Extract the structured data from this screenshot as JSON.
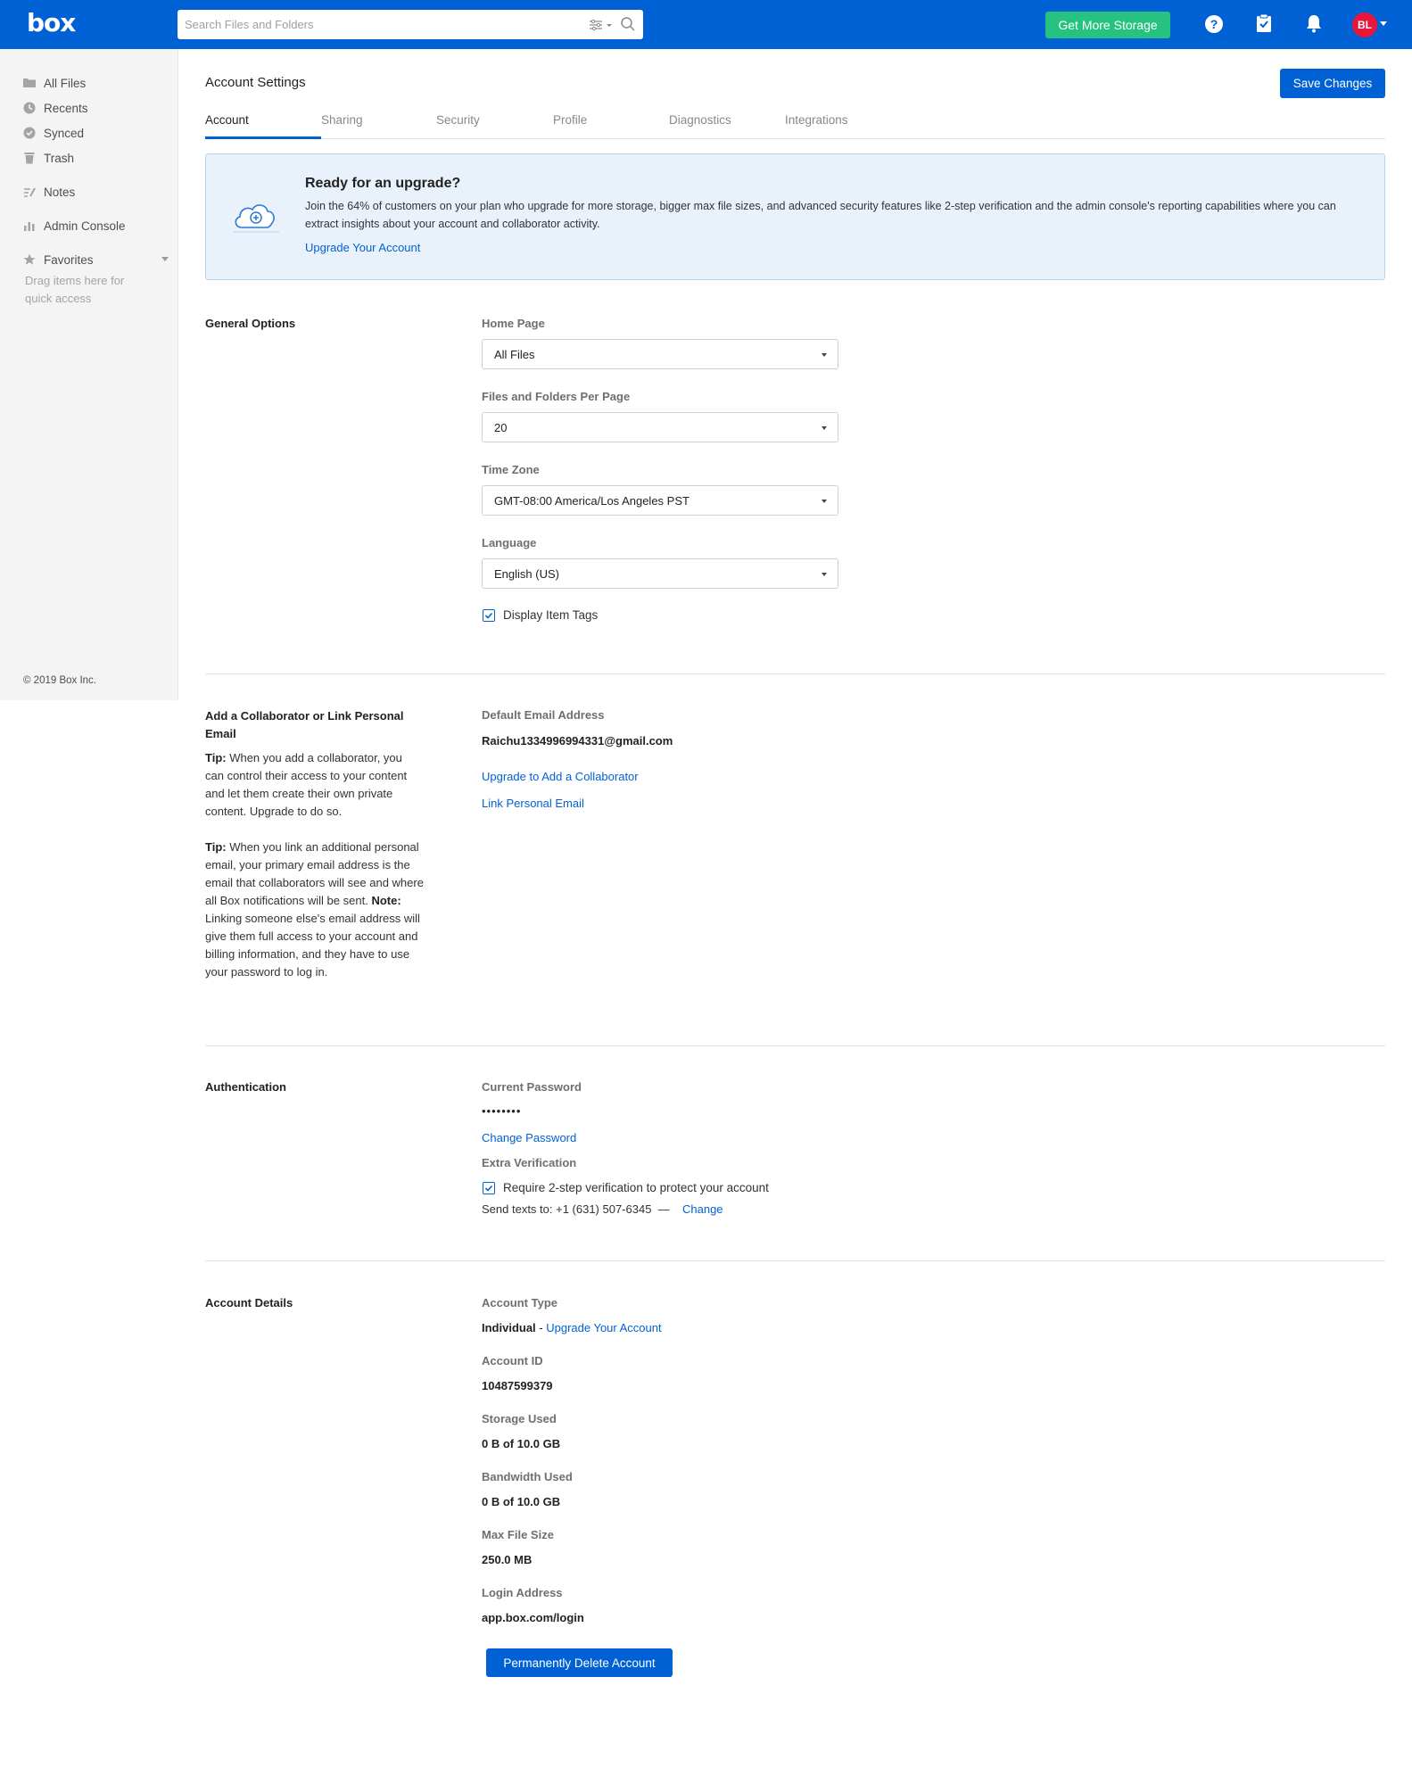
{
  "header": {
    "logo": "box",
    "search_placeholder": "Search Files and Folders",
    "storage_button": "Get More Storage",
    "help_icon": "?",
    "avatar_initials": "BL",
    "brand_color": "#0061d5",
    "storage_color": "#26c281",
    "avatar_color": "#e9163b"
  },
  "sidebar": {
    "items": [
      {
        "label": "All Files",
        "icon": "folder-icon"
      },
      {
        "label": "Recents",
        "icon": "clock-icon"
      },
      {
        "label": "Synced",
        "icon": "sync-icon"
      },
      {
        "label": "Trash",
        "icon": "trash-icon"
      },
      {
        "label": "Notes",
        "icon": "notes-icon"
      },
      {
        "label": "Admin Console",
        "icon": "chart-icon"
      },
      {
        "label": "Favorites",
        "icon": "star-icon"
      }
    ],
    "favorites_hint": "Drag items here for quick access",
    "copyright": "© 2019 Box Inc."
  },
  "page": {
    "title": "Account Settings",
    "save_button": "Save Changes",
    "tabs": [
      "Account",
      "Sharing",
      "Security",
      "Profile",
      "Diagnostics",
      "Integrations"
    ],
    "active_tab": "Account"
  },
  "banner": {
    "title": "Ready for an upgrade?",
    "text": "Join the 64% of customers on your plan who upgrade for more storage, bigger max file sizes, and advanced security features like 2-step verification and the admin console's reporting capabilities where you can extract insights about your account and collaborator activity.",
    "link": "Upgrade Your Account"
  },
  "general": {
    "title": "General Options",
    "home_page_label": "Home Page",
    "home_page_value": "All Files",
    "per_page_label": "Files and Folders Per Page",
    "per_page_value": "20",
    "timezone_label": "Time Zone",
    "timezone_value": "GMT-08:00 America/Los Angeles PST",
    "language_label": "Language",
    "language_value": "English (US)",
    "display_tags_label": "Display Item Tags",
    "display_tags_checked": true
  },
  "collaborator": {
    "title": "Add a Collaborator or Link Personal Email",
    "tip1_lead": "Tip:",
    "tip1_text": " When you add a collaborator, you can control their access to your content and let them create their own private content. Upgrade to do so.",
    "tip2_lead": "Tip:",
    "tip2_text": " When you link an additional personal email, your primary email address is the email that collaborators will see and where all Box notifications will be sent. ",
    "tip2_note_lead": "Note:",
    "tip2_note_text": " Linking someone else's email address will give them full access to your account and billing information, and they have to use your password to log in.",
    "default_email_label": "Default Email Address",
    "default_email_value": "Raichu1334996994331@gmail.com",
    "upgrade_collab_link": "Upgrade to Add a Collaborator",
    "link_email_link": "Link Personal Email"
  },
  "auth": {
    "title": "Authentication",
    "password_label": "Current Password",
    "password_value": "••••••••",
    "change_password_link": "Change Password",
    "extra_verification_label": "Extra Verification",
    "two_step_label": "Require 2-step verification to protect your account",
    "two_step_checked": true,
    "send_texts": "Send texts to: +1 (631) 507-6345  —",
    "change_link": "Change"
  },
  "details": {
    "title": "Account Details",
    "account_type_label": "Account Type",
    "account_type_value": "Individual",
    "account_type_sep": " - ",
    "account_type_link": "Upgrade Your Account",
    "account_id_label": "Account ID",
    "account_id_value": "10487599379",
    "storage_label": "Storage Used",
    "storage_value": "0 B of 10.0 GB",
    "bandwidth_label": "Bandwidth Used",
    "bandwidth_value": "0 B of 10.0 GB",
    "max_file_label": "Max File Size",
    "max_file_value": "250.0 MB",
    "login_label": "Login Address",
    "login_value": "app.box.com/login",
    "delete_button": "Permanently Delete Account"
  }
}
